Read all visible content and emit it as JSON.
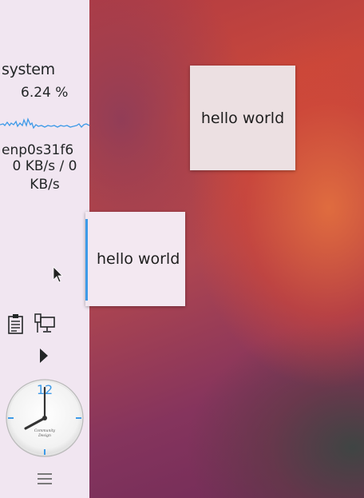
{
  "panel": {
    "system_monitor": {
      "title": "system",
      "cpu_usage": "6.24 %",
      "network_interface": "enp0s31f6",
      "network_rate": "0 KB/s / 0 KB/s"
    },
    "tray": {
      "icons": [
        "clipboard-icon",
        "network-icon"
      ]
    },
    "clock": {
      "hour_label": "12",
      "brand_line1": "Community",
      "brand_line2": "Design"
    }
  },
  "windows": [
    {
      "text": "hello world"
    },
    {
      "text": "hello world"
    }
  ],
  "colors": {
    "panel_bg": "#f1e6f1",
    "accent": "#3d9ae8",
    "text": "#232627"
  }
}
